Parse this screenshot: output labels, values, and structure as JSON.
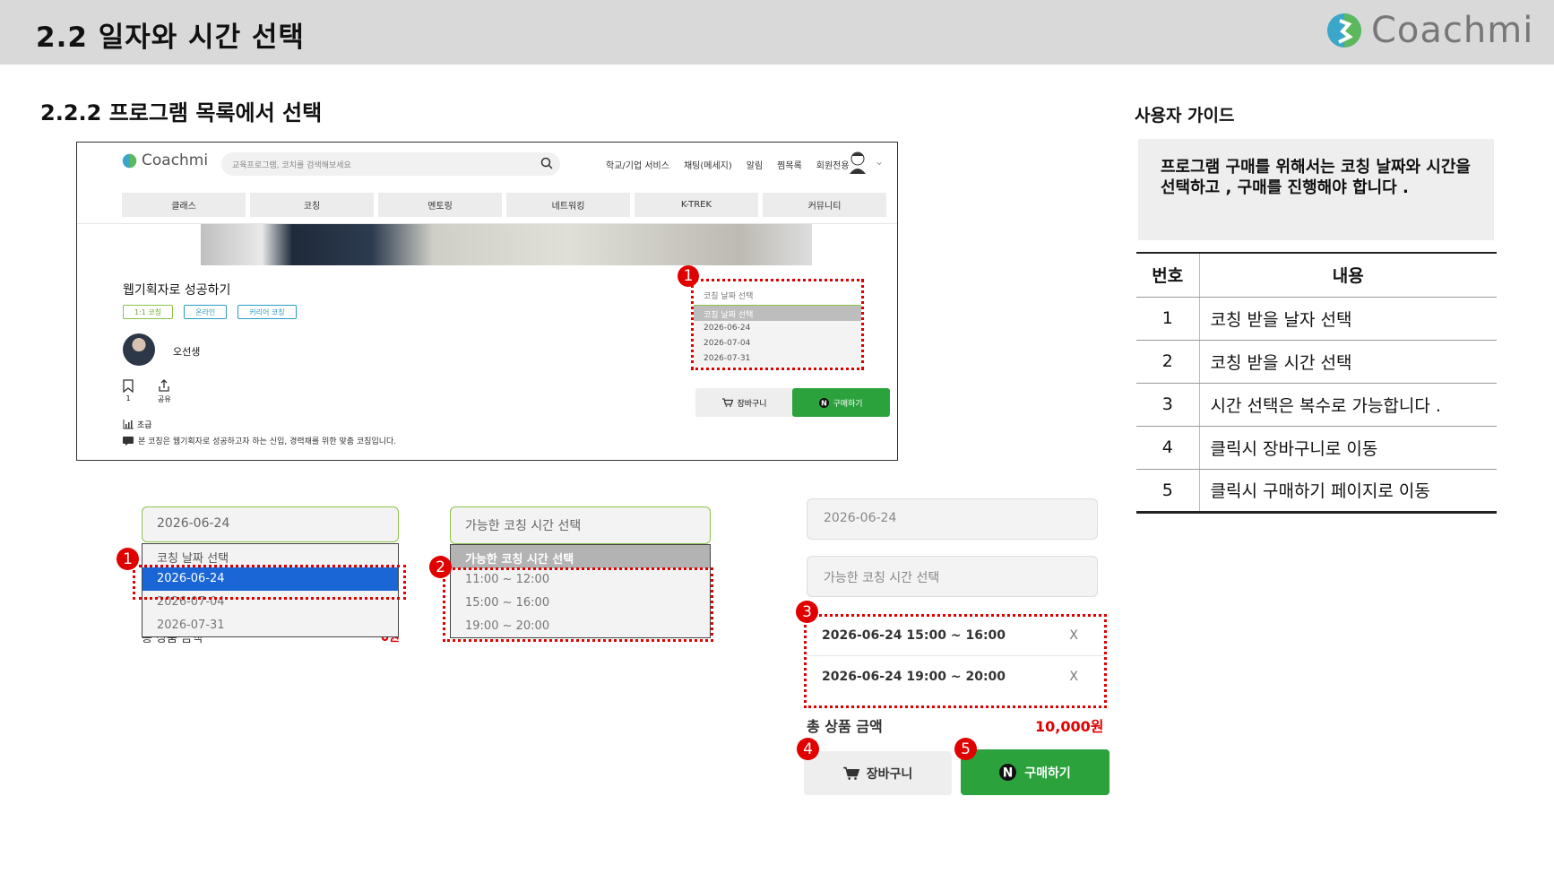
{
  "header": {
    "title": "2.2  일자와 시간 선택",
    "logo_text": "Coachmi"
  },
  "subtitle": "2.2.2  프로그램 목록에서 선택",
  "site": {
    "logo_text": "Coachmi",
    "search_placeholder": "교육프로그램, 코치를 검색해보세요",
    "nav": [
      "학교/기업 서비스",
      "채팅(메세지)",
      "알림",
      "찜목록",
      "회원전용"
    ],
    "tabs": [
      "클래스",
      "코칭",
      "멘토링",
      "네트워킹",
      "K-TREK",
      "커뮤니티"
    ],
    "program_title": "웹기획자로 성공하기",
    "badges": [
      "1:1 코칭",
      "온라인",
      "커리어 코칭"
    ],
    "teacher": "오선생",
    "bookmark_count": "1",
    "share_label": "공유",
    "level": "초급",
    "description": "본 코칭은 웹기획자로 성공하고자 하는 신입, 경력채를 위한 맞춤 코칭입니다.",
    "date_select_placeholder": "코칭 날짜 선택",
    "date_options": [
      "코칭 날짜 선택",
      "2026-06-24",
      "2026-07-04",
      "2026-07-31"
    ],
    "cart_label": "장바구니",
    "buy_label": "구매하기"
  },
  "step1": {
    "field_value": "2026-06-24",
    "options": [
      "코칭 날짜 선택",
      "2026-06-24",
      "2026-07-04",
      "2026-07-31"
    ],
    "behind_left": "총 상품 금액",
    "behind_right": "0원"
  },
  "step2": {
    "field_placeholder": "가능한 코칭 시간 선택",
    "options": [
      "가능한 코칭 시간 선택",
      "11:00 ~ 12:00",
      "15:00 ~ 16:00",
      "19:00 ~ 20:00"
    ]
  },
  "step3": {
    "date_value": "2026-06-24",
    "time_placeholder": "가능한 코칭 시간 선택",
    "selected": [
      {
        "label": "2026-06-24 15:00 ~ 16:00",
        "remove": "X"
      },
      {
        "label": "2026-06-24 19:00 ~ 20:00",
        "remove": "X"
      }
    ],
    "total_label": "총 상품 금액",
    "total_value": "10,000원",
    "cart_label": "장바구니",
    "buy_label": "구매하기"
  },
  "markers": [
    "1",
    "2",
    "3",
    "4",
    "5"
  ],
  "guide": {
    "heading": "사용자 가이드",
    "note": "프로그램 구매를 위해서는 코칭 날짜와 시간을 선택하고 ,  구매를 진행해야 합니다 .",
    "col_num": "번호",
    "col_content": "내용",
    "rows": [
      {
        "num": "1",
        "text": "코칭 받을 날자 선택"
      },
      {
        "num": "2",
        "text": "코칭 받을 시간 선택"
      },
      {
        "num": "3",
        "text": "시간 선택은 복수로 가능합니다 ."
      },
      {
        "num": "4",
        "text": "클릭시 장바구니로 이동"
      },
      {
        "num": "5",
        "text": "클릭시 구매하기 페이지로 이동"
      }
    ]
  },
  "colors": {
    "accent_red": "#e00000",
    "brand_green": "#2ba23c",
    "header_gray": "#d9d9d9",
    "select_blue": "#1a66d6"
  }
}
